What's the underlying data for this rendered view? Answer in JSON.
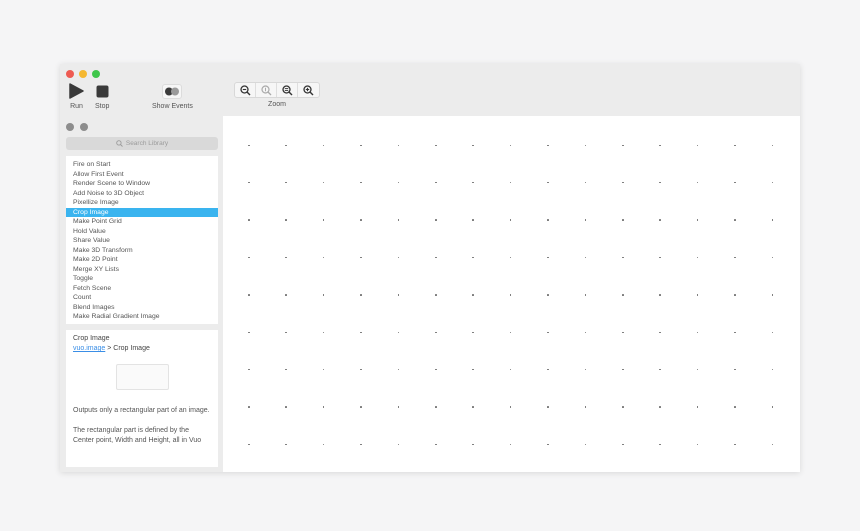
{
  "toolbar": {
    "run_label": "Run",
    "stop_label": "Stop",
    "show_events_label": "Show Events",
    "zoom_label": "Zoom"
  },
  "library": {
    "search_placeholder": "Search Library",
    "items": [
      "Fire on Start",
      "Allow First Event",
      "Render Scene to Window",
      "Add Noise to 3D Object",
      "Pixellize Image",
      "Crop Image",
      "Make Point Grid",
      "Hold Value",
      "Share Value",
      "Make 3D Transform",
      "Make 2D Point",
      "Merge XY Lists",
      "Toggle",
      "Fetch Scene",
      "Count",
      "Blend Images",
      "Make Radial Gradient Image"
    ],
    "selected_item": "Crop Image"
  },
  "doc": {
    "title": "Crop Image",
    "path_link": "vuo.image",
    "path_separator": " > ",
    "path_name": "Crop Image",
    "desc1": "Outputs only a rectangular part of an image.",
    "desc2": "The rectangular part is defined by the Center point, Width and Height, all in Vuo"
  },
  "colors": {
    "accent": "#3ab4ef",
    "close": "#ee5b52",
    "minimize": "#f5b831",
    "zoom": "#3fc64b"
  }
}
